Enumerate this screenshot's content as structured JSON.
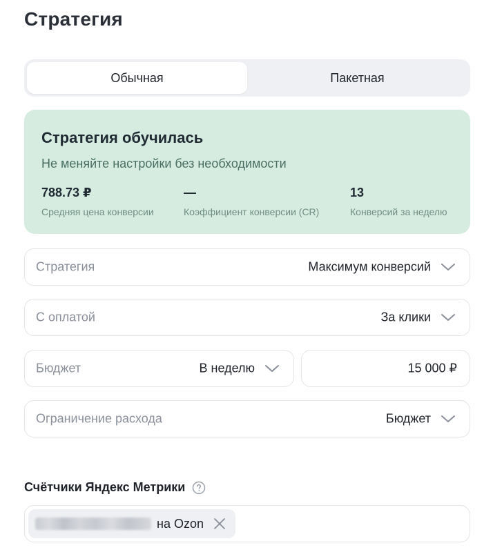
{
  "page": {
    "title": "Стратегия"
  },
  "tabs": [
    {
      "label": "Обычная",
      "active": true
    },
    {
      "label": "Пакетная",
      "active": false
    }
  ],
  "info_card": {
    "title": "Стратегия обучилась",
    "subtitle": "Не меняйте настройки без необходимости",
    "stats": [
      {
        "value": "788.73 ₽",
        "label": "Средняя цена конверсии"
      },
      {
        "value": "—",
        "label": "Коэффициент конверсии (CR)"
      },
      {
        "value": "13",
        "label": "Конверсий за неделю"
      }
    ],
    "background": "#d6ece0"
  },
  "fields": {
    "strategy": {
      "label": "Стратегия",
      "value": "Максимум конверсий"
    },
    "payment": {
      "label": "С оплатой",
      "value": "За клики"
    },
    "budget": {
      "label": "Бюджет",
      "period": "В неделю",
      "amount": "15 000  ₽"
    },
    "limit": {
      "label": "Ограничение расхода",
      "value": "Бюджет"
    }
  },
  "metrika": {
    "title": "Счётчики Яндекс Метрики",
    "help_icon": "question-circle-icon",
    "tags": [
      {
        "text": "на Ozon",
        "blurred_prefix": true
      }
    ]
  }
}
